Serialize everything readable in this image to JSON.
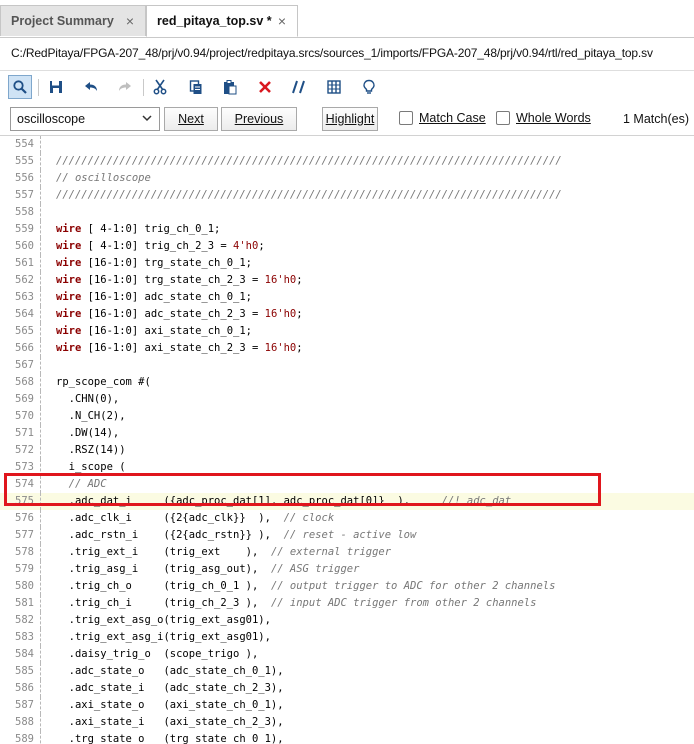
{
  "tabs": [
    {
      "label": "Project Summary",
      "close": "×",
      "active": false
    },
    {
      "label": "red_pitaya_top.sv *",
      "close": "×",
      "active": true
    }
  ],
  "file_path": "C:/RedPitaya/FPGA-207_48/prj/v0.94/project/redpitaya.srcs/sources_1/imports/FPGA-207_48/prj/v0.94/rtl/red_pitaya_top.sv",
  "toolbar": {
    "icons": [
      "search-icon",
      "save-icon",
      "undo-icon",
      "redo-icon",
      "cut-icon",
      "copy-icon",
      "paste-icon",
      "delete-icon",
      "comment-icon",
      "column-select-icon",
      "bulb-icon"
    ]
  },
  "find": {
    "query": "oscilloscope",
    "next_label": "Next",
    "previous_label": "Previous",
    "highlight_label": "Highlight",
    "match_case_label": "Match Case",
    "whole_words_label": "Whole Words",
    "matches_text": "1 Match(es)"
  },
  "colors": {
    "keyword": "#8b0000",
    "comment": "#777777",
    "current_line": "#fbfbe2",
    "annotation_box": "#e0161d"
  },
  "current_line_number": 575,
  "code_lines": [
    {
      "n": "554",
      "t": ""
    },
    {
      "n": "555",
      "t": "////////////////////////////////////////////////////////////////////////////////",
      "c": "cm"
    },
    {
      "n": "556",
      "t": "// oscilloscope",
      "c": "cm"
    },
    {
      "n": "557",
      "t": "////////////////////////////////////////////////////////////////////////////////",
      "c": "cm"
    },
    {
      "n": "558",
      "t": ""
    },
    {
      "n": "559",
      "k": "wire",
      "t": " [ 4-1:0] trig_ch_0_1;"
    },
    {
      "n": "560",
      "k": "wire",
      "t": " [ 4-1:0] trig_ch_2_3 = 4'h0;"
    },
    {
      "n": "561",
      "k": "wire",
      "t": " [16-1:0] trg_state_ch_0_1;"
    },
    {
      "n": "562",
      "k": "wire",
      "t": " [16-1:0] trg_state_ch_2_3 = 16'h0;"
    },
    {
      "n": "563",
      "k": "wire",
      "t": " [16-1:0] adc_state_ch_0_1;"
    },
    {
      "n": "564",
      "k": "wire",
      "t": " [16-1:0] adc_state_ch_2_3 = 16'h0;"
    },
    {
      "n": "565",
      "k": "wire",
      "t": " [16-1:0] axi_state_ch_0_1;"
    },
    {
      "n": "566",
      "k": "wire",
      "t": " [16-1:0] axi_state_ch_2_3 = 16'h0;"
    },
    {
      "n": "567",
      "t": ""
    },
    {
      "n": "568",
      "t": "rp_scope_com #("
    },
    {
      "n": "569",
      "t": "  .CHN(0),"
    },
    {
      "n": "570",
      "t": "  .N_CH(2),"
    },
    {
      "n": "571",
      "t": "  .DW(14),"
    },
    {
      "n": "572",
      "t": "  .RSZ(14))"
    },
    {
      "n": "573",
      "t": "  i_scope ("
    },
    {
      "n": "574",
      "t": "  // ADC",
      "c": "cm"
    },
    {
      "n": "575",
      "t": "  .adc_dat_i     ({adc_proc_dat[1], adc_proc_dat[0]}  ),     ",
      "cm": "//! adc_dat"
    },
    {
      "n": "576",
      "t": "  .adc_clk_i     ({2{adc_clk}}  ),  ",
      "cm": "// clock"
    },
    {
      "n": "577",
      "t": "  .adc_rstn_i    ({2{adc_rstn}} ),  ",
      "cm": "// reset - active low"
    },
    {
      "n": "578",
      "t": "  .trig_ext_i    (trig_ext    ),  ",
      "cm": "// external trigger"
    },
    {
      "n": "579",
      "t": "  .trig_asg_i    (trig_asg_out),  ",
      "cm": "// ASG trigger"
    },
    {
      "n": "580",
      "t": "  .trig_ch_o     (trig_ch_0_1 ),  ",
      "cm": "// output trigger to ADC for other 2 channels"
    },
    {
      "n": "581",
      "t": "  .trig_ch_i     (trig_ch_2_3 ),  ",
      "cm": "// input ADC trigger from other 2 channels"
    },
    {
      "n": "582",
      "t": "  .trig_ext_asg_o(trig_ext_asg01),"
    },
    {
      "n": "583",
      "t": "  .trig_ext_asg_i(trig_ext_asg01),"
    },
    {
      "n": "584",
      "t": "  .daisy_trig_o  (scope_trigo ),"
    },
    {
      "n": "585",
      "t": "  .adc_state_o   (adc_state_ch_0_1),"
    },
    {
      "n": "586",
      "t": "  .adc_state_i   (adc_state_ch_2_3),"
    },
    {
      "n": "587",
      "t": "  .axi_state_o   (axi_state_ch_0_1),"
    },
    {
      "n": "588",
      "t": "  .axi_state_i   (axi_state_ch_2_3),"
    },
    {
      "n": "589",
      "t": "  .trg_state_o   (trg_state_ch_0_1),"
    }
  ]
}
